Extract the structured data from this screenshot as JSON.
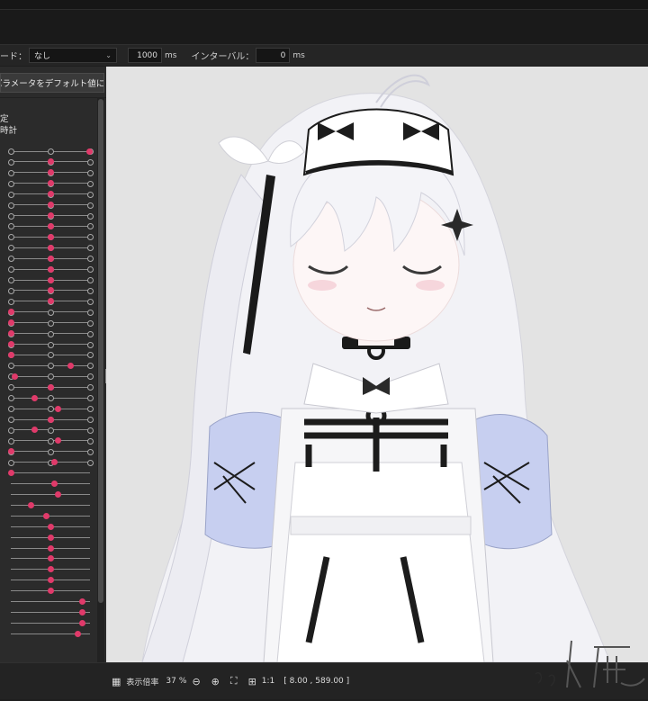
{
  "toolbar": {
    "mode_label": "ード：",
    "mode_value": "なし",
    "duration_value": "1000",
    "duration_unit": "ms",
    "interval_label": "インターバル：",
    "interval_value": "0",
    "interval_unit": "ms"
  },
  "left_panel": {
    "reset_button": "パラメータをデフォルト値に戻す",
    "label_1": "定",
    "label_2": "時計",
    "slider_rows": [
      {
        "type": "dots",
        "knob": 0.99
      },
      {
        "type": "dots",
        "knob": 0.5
      },
      {
        "type": "dots",
        "knob": 0.5
      },
      {
        "type": "dots",
        "knob": 0.5
      },
      {
        "type": "dots",
        "knob": 0.5
      },
      {
        "type": "dots",
        "knob": 0.5
      },
      {
        "type": "dots",
        "knob": 0.5
      },
      {
        "type": "dots",
        "knob": 0.5
      },
      {
        "type": "dots",
        "knob": 0.5
      },
      {
        "type": "dots",
        "knob": 0.5
      },
      {
        "type": "dots",
        "knob": 0.5
      },
      {
        "type": "dots",
        "knob": 0.5
      },
      {
        "type": "dots",
        "knob": 0.5
      },
      {
        "type": "dots",
        "knob": 0.5
      },
      {
        "type": "dots",
        "knob": 0.5
      },
      {
        "type": "dots",
        "knob": 0.0
      },
      {
        "type": "dots",
        "knob": 0.0
      },
      {
        "type": "dots",
        "knob": 0.0
      },
      {
        "type": "dots",
        "knob": 0.0
      },
      {
        "type": "dots",
        "knob": 0.0
      },
      {
        "type": "dots",
        "knob": 0.75
      },
      {
        "type": "dots",
        "knob": 0.05
      },
      {
        "type": "dots",
        "knob": 0.5
      },
      {
        "type": "dots",
        "knob": 0.3
      },
      {
        "type": "dots",
        "knob": 0.6
      },
      {
        "type": "dots",
        "knob": 0.5
      },
      {
        "type": "dots",
        "knob": 0.3
      },
      {
        "type": "dots",
        "knob": 0.6
      },
      {
        "type": "dots",
        "knob": 0.0
      },
      {
        "type": "dots",
        "knob": 0.55
      },
      {
        "type": "line",
        "knob": 0.0
      },
      {
        "type": "line",
        "knob": 0.55
      },
      {
        "type": "line",
        "knob": 0.6
      },
      {
        "type": "line",
        "knob": 0.25
      },
      {
        "type": "line",
        "knob": 0.45
      },
      {
        "type": "line",
        "knob": 0.5
      },
      {
        "type": "line",
        "knob": 0.5
      },
      {
        "type": "line",
        "knob": 0.5
      },
      {
        "type": "line",
        "knob": 0.5
      },
      {
        "type": "line",
        "knob": 0.5
      },
      {
        "type": "line",
        "knob": 0.5
      },
      {
        "type": "line",
        "knob": 0.5
      },
      {
        "type": "line",
        "knob": 0.9
      },
      {
        "type": "line",
        "knob": 0.9
      },
      {
        "type": "line",
        "knob": 0.9
      },
      {
        "type": "line",
        "knob": 0.85
      }
    ]
  },
  "status": {
    "zoom_label": "表示倍率",
    "zoom_value": "37",
    "zoom_unit": "%",
    "ratio_label": "1:1",
    "coords": "[    8.00 , 589.00 ]"
  },
  "watermark": "入鹿",
  "colors": {
    "knob": "#e03a6a",
    "canvas": "#e3e3e3",
    "panel": "#2b2b2b"
  }
}
